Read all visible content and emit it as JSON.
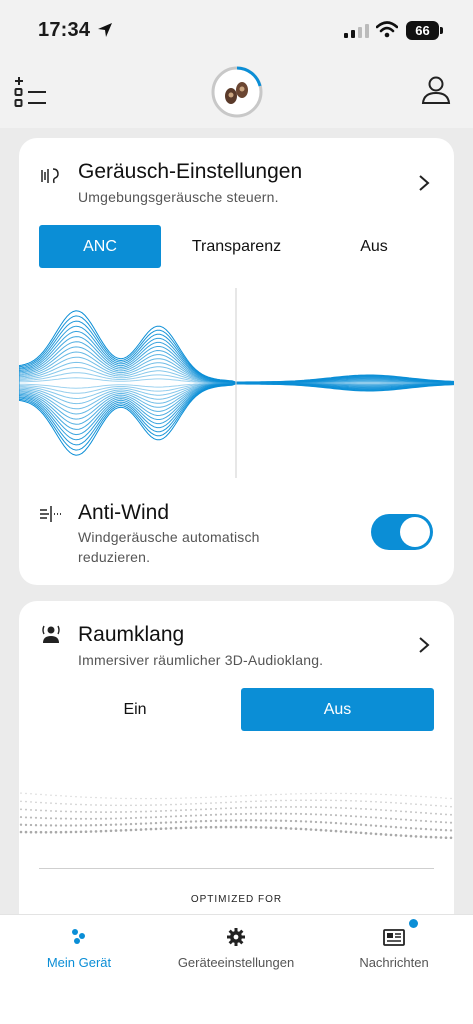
{
  "status_bar": {
    "time": "17:34",
    "battery": "66"
  },
  "noise_card": {
    "title": "Geräusch-Einstellungen",
    "subtitle": "Umgebungsgeräusche steuern.",
    "modes": [
      "ANC",
      "Transparenz",
      "Aus"
    ],
    "selected_mode": "ANC",
    "anti_wind": {
      "title": "Anti-Wind",
      "subtitle_line1": "Windgeräusche automatisch",
      "subtitle_line2": "reduzieren.",
      "enabled": true
    }
  },
  "spatial_card": {
    "title": "Raumklang",
    "subtitle": "Immersiver räumlicher 3D-Audioklang.",
    "options": [
      "Ein",
      "Aus"
    ],
    "selected_option": "Aus",
    "optimized_for": "OPTIMIZED FOR"
  },
  "tab_bar": {
    "tabs": [
      {
        "label": "Mein Gerät",
        "icon": "device-icon",
        "active": true
      },
      {
        "label": "Geräteeinstellungen",
        "icon": "gear-icon",
        "active": false
      },
      {
        "label": "Nachrichten",
        "icon": "news-icon",
        "active": false,
        "badge": true
      }
    ]
  },
  "colors": {
    "accent": "#0b8ed6",
    "background": "#ebebeb",
    "card": "#ffffff"
  }
}
